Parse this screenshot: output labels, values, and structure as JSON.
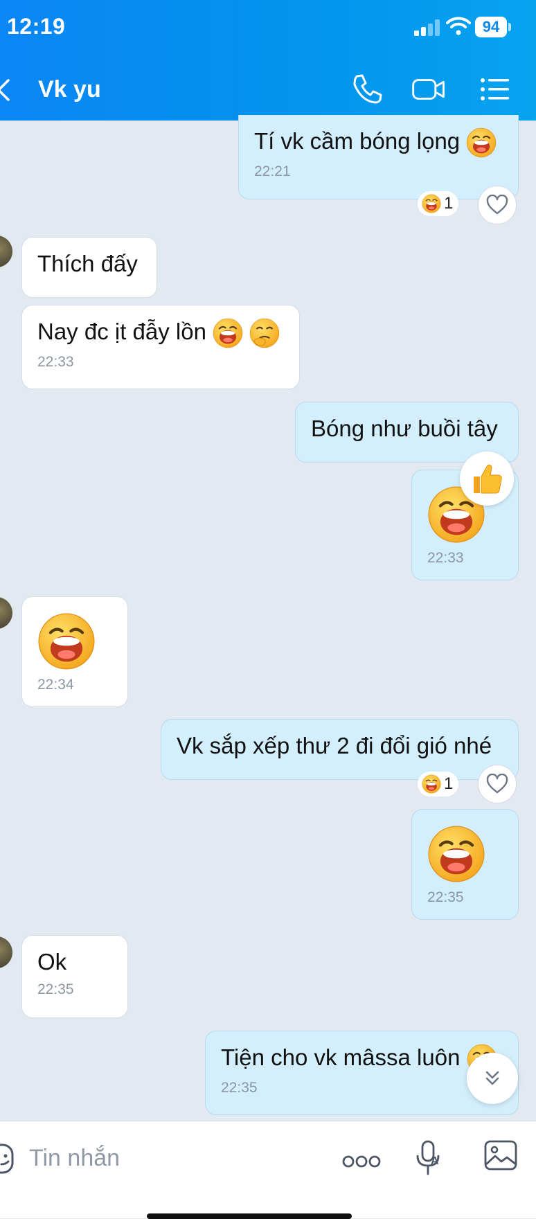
{
  "status_bar": {
    "time": "12:19",
    "battery": "94"
  },
  "header": {
    "title": "Vk yu"
  },
  "messages": [
    {
      "text": "Tí vk cầm bóng lọng",
      "time": "22:21",
      "reaction_count": "1"
    },
    {
      "text": "Thích đấy"
    },
    {
      "text": "Nay đc ịt đẫy lồn",
      "time": "22:33"
    },
    {
      "text": "Bóng như buồi tây"
    },
    {
      "time": "22:33"
    },
    {
      "time": "22:34"
    },
    {
      "text": "Vk sắp xếp thư 2 đi đổi gió nhé",
      "reaction_count": "1"
    },
    {
      "time": "22:35"
    },
    {
      "text": "Ok",
      "time": "22:35"
    },
    {
      "text": "Tiện cho vk mâssa luôn",
      "time": "22:35"
    }
  ],
  "input_bar": {
    "placeholder": "Tin nhắn"
  },
  "colors": {
    "header": "#0a8af0",
    "sent_bubble": "#d3eefc",
    "received_bubble": "#ffffff",
    "chat_background": "#e2e9f1"
  },
  "icons": {
    "header": [
      "back-icon",
      "phone-icon",
      "video-call-icon",
      "menu-list-icon"
    ],
    "reactions": [
      "laughing-emoji",
      "heart-icon",
      "thumbs-up-icon"
    ],
    "input": [
      "sticker-icon",
      "more-dots-icon",
      "voice-input-icon",
      "image-icon",
      "scroll-down-icon"
    ]
  }
}
